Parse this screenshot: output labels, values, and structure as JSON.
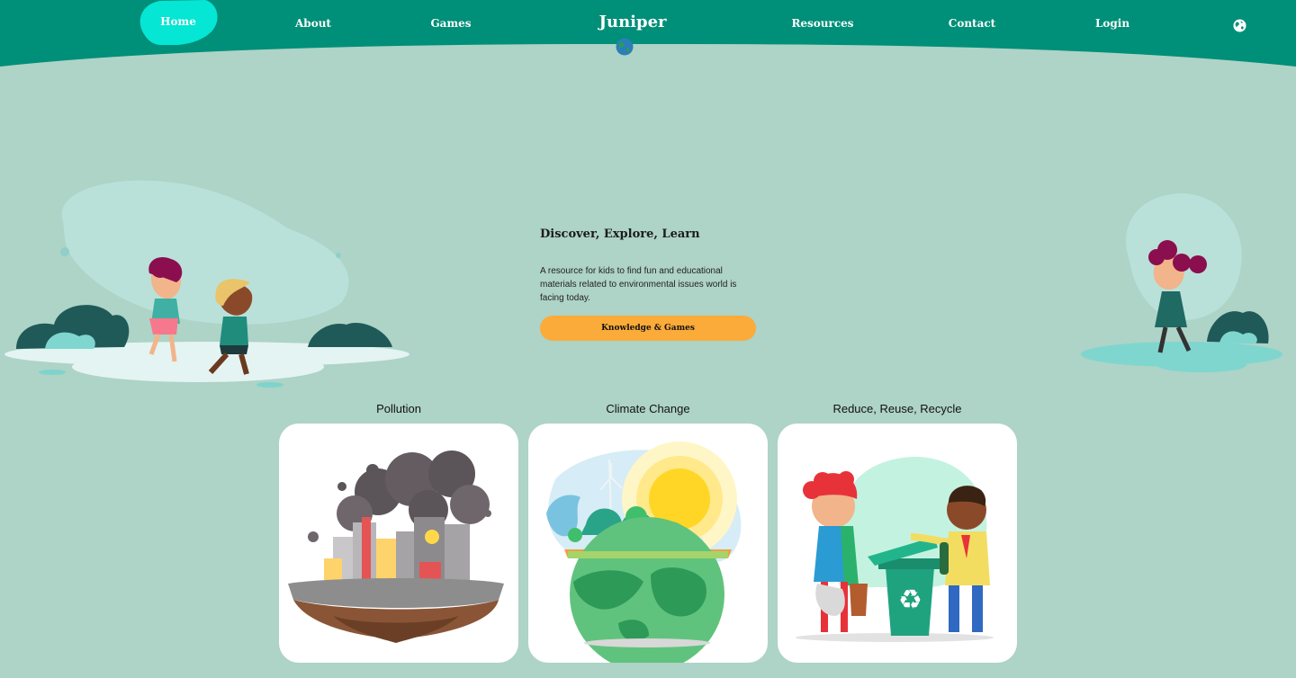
{
  "nav": {
    "home": "Home",
    "about": "About",
    "games": "Games",
    "brand": "Juniper",
    "resources": "Resources",
    "contact": "Contact",
    "login": "Login"
  },
  "hero": {
    "title": "Discover, Explore, Learn",
    "description": "A resource for kids to find fun and educational materials related to environmental issues world is facing today.",
    "button": "Knowledge & Games"
  },
  "cards": [
    {
      "title": "Pollution"
    },
    {
      "title": "Climate Change"
    },
    {
      "title": "Reduce, Reuse, Recycle"
    }
  ],
  "colors": {
    "nav": "#008f78",
    "background": "#aed3c7",
    "home_highlight": "#05e6d4",
    "button": "#fbab39"
  },
  "icons": {
    "brand": "globe-icon",
    "language": "globe-icon"
  }
}
